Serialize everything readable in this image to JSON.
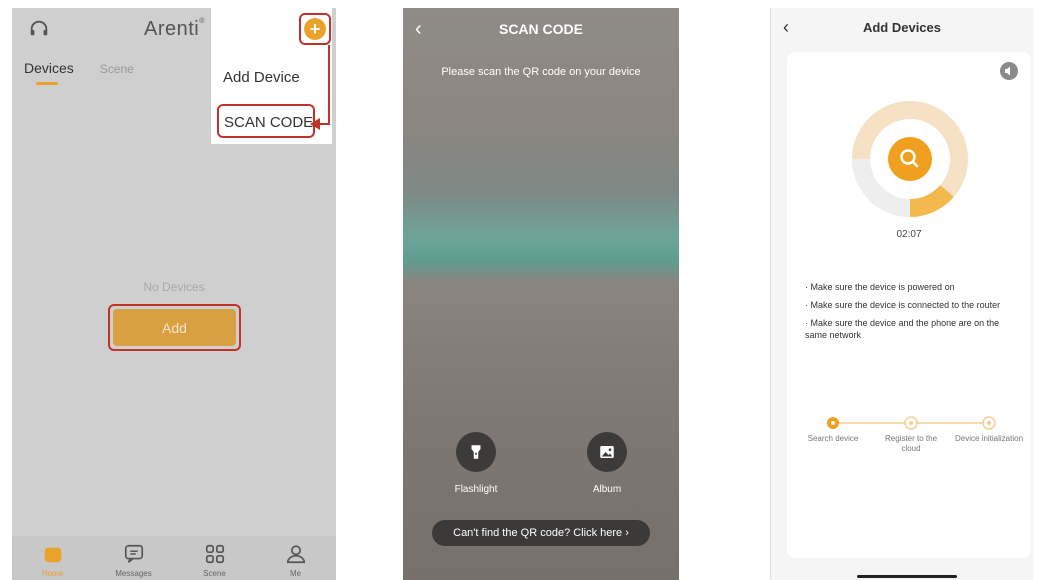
{
  "screen1": {
    "brand": "Arenti",
    "brand_mark": "®",
    "tabs": [
      "Devices",
      "Scene"
    ],
    "menu": {
      "add_device": "Add Device",
      "scan_code": "SCAN CODE"
    },
    "empty_text": "No Devices",
    "add_button": "Add",
    "nav": [
      "Home",
      "Messages",
      "Scene",
      "Me"
    ],
    "icons": [
      "headset-icon",
      "plus-icon",
      "home-icon",
      "message-icon",
      "grid-icon",
      "user-icon"
    ],
    "highlight_color": "#c0332b",
    "accent_color": "#e9a32b"
  },
  "screen2": {
    "title": "SCAN CODE",
    "instruction": "Please scan the QR code on your device",
    "flashlight_label": "Flashlight",
    "album_label": "Album",
    "help_button": "Can't find the QR code? Click here  ›",
    "icons": [
      "back-icon",
      "flashlight-icon",
      "album-icon"
    ]
  },
  "screen3": {
    "title": "Add Devices",
    "timer": "02:07",
    "tips": [
      "· Make sure the device is powered on",
      "· Make sure the device is connected to the router",
      "· Make sure the device and the phone are on the same network"
    ],
    "steps": [
      "Search device",
      "Register to the cloud",
      "Device initialization"
    ],
    "icons": [
      "back-icon",
      "volume-icon",
      "search-icon"
    ],
    "accent_color": "#f0a01e"
  }
}
